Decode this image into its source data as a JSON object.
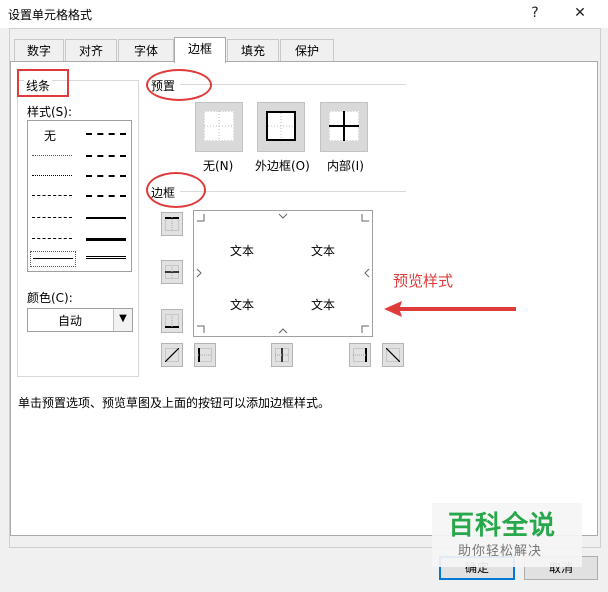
{
  "window": {
    "title": "设置单元格格式",
    "help_glyph": "?",
    "close_glyph": "✕"
  },
  "tabs": [
    {
      "label": "数字"
    },
    {
      "label": "对齐"
    },
    {
      "label": "字体"
    },
    {
      "label": "边框",
      "active": true
    },
    {
      "label": "填充"
    },
    {
      "label": "保护"
    }
  ],
  "line_group": {
    "title": "线条",
    "style_label": "样式(S):",
    "none_label": "无",
    "color_label": "颜色(C):",
    "color_value": "自动"
  },
  "presets": {
    "title": "预置",
    "items": [
      {
        "label": "无(N)"
      },
      {
        "label": "外边框(O)"
      },
      {
        "label": "内部(I)"
      }
    ]
  },
  "border": {
    "title": "边框",
    "preview_text": [
      "文本",
      "文本",
      "文本",
      "文本"
    ]
  },
  "annotation": {
    "text": "预览样式",
    "color": "#e03b3b"
  },
  "hint": "单击预置选项、预览草图及上面的按钮可以添加边框样式。",
  "buttons": {
    "ok": "确定",
    "cancel": "取消"
  },
  "watermark": {
    "main": "百科全说",
    "sub": "助你轻松解决"
  },
  "colors": {
    "accent": "#0078d7",
    "highlight": "#e03b3b",
    "watermark": "#27a84a"
  }
}
